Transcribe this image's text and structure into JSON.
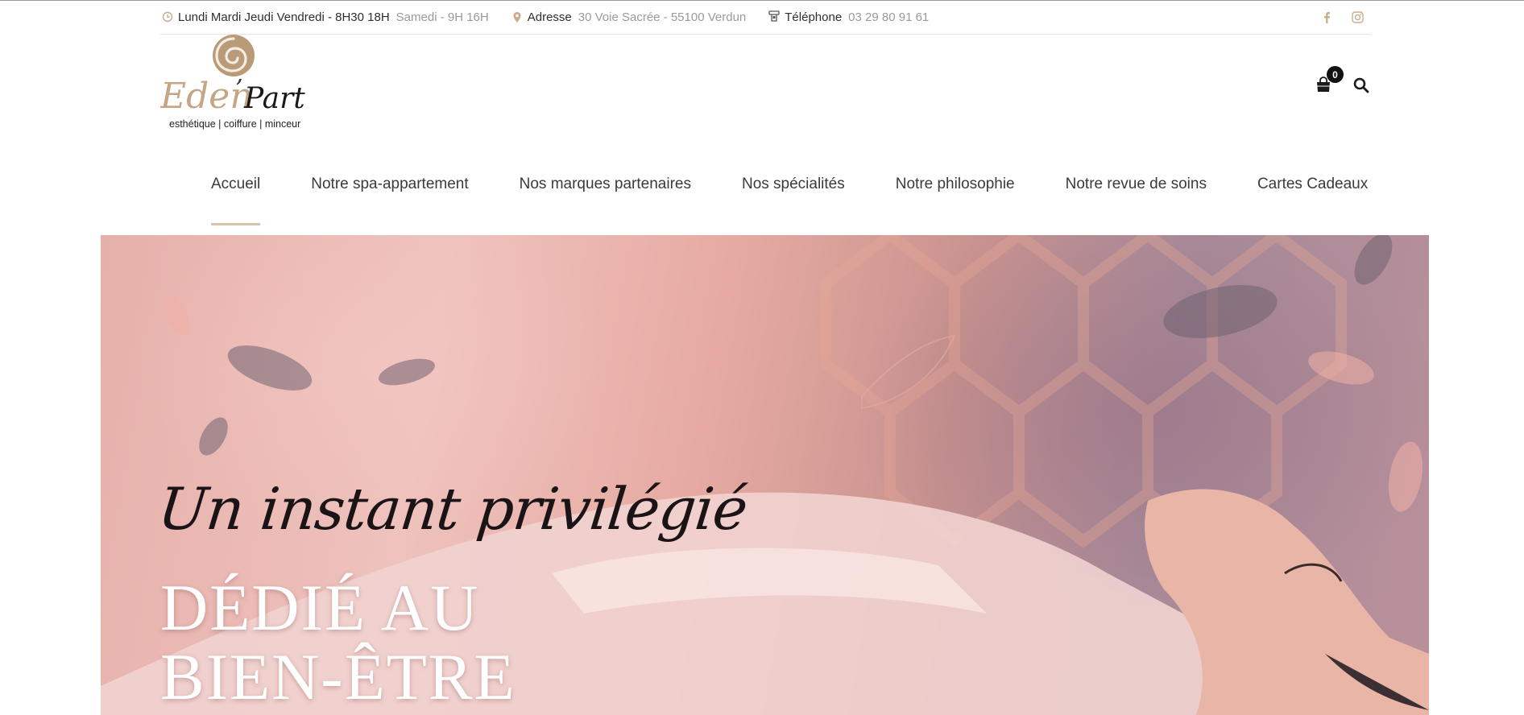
{
  "topbar": {
    "hours_label": "Lundi Mardi Jeudi Vendredi - 8H30 18H",
    "hours_value": "Samedi - 9H 16H",
    "address_label": "Adresse",
    "address_value": "30 Voie Sacrée - 55100 Verdun",
    "phone_label": "Téléphone",
    "phone_value": "03 29 80 91 61",
    "socials": [
      "facebook-icon",
      "instagram-icon"
    ]
  },
  "logo": {
    "name_script": "Eden",
    "apostrophe": "’",
    "name_script_2": "Part",
    "tagline": "esthétique | coiffure | minceur"
  },
  "header": {
    "cart_count": "0"
  },
  "nav": {
    "items": [
      {
        "label": "Accueil",
        "active": true
      },
      {
        "label": "Notre spa-appartement"
      },
      {
        "label": "Nos marques partenaires"
      },
      {
        "label": "Nos spécialités"
      },
      {
        "label": "Notre philosophie"
      },
      {
        "label": "Notre revue de soins"
      },
      {
        "label": "Cartes Cadeaux"
      }
    ]
  },
  "hero": {
    "script_line": "Un instant privilégié",
    "title_line_1": "DÉDIÉ AU",
    "title_line_2": "BIEN-ÊTRE"
  },
  "colors": {
    "accent_gold": "#c8ad8f",
    "nav_underline": "#d8c3ad",
    "muted_text": "#9a9a9a"
  }
}
